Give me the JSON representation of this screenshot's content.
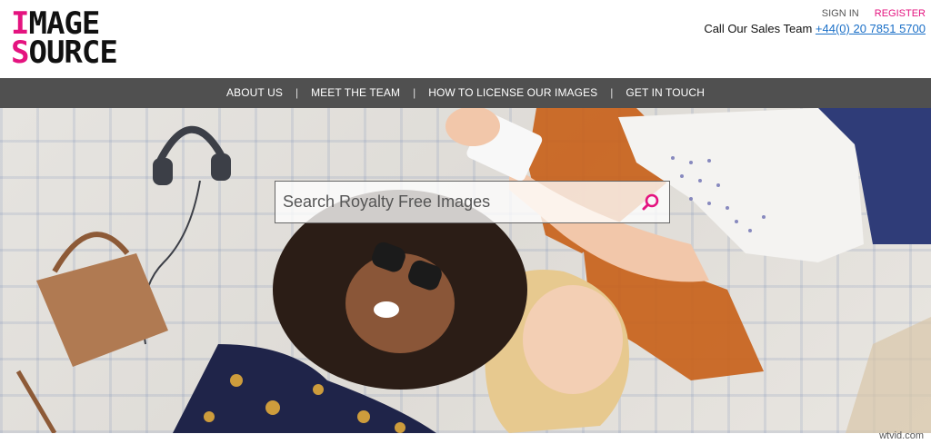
{
  "brand": {
    "logo_line1": "IMAGE",
    "logo_line2": "SOURCE",
    "accent_color": "#e4137f"
  },
  "header": {
    "sign_in": "SIGN IN",
    "register": "REGISTER",
    "sales_label": "Call Our Sales Team",
    "sales_phone": "+44(0) 20 7851 5700"
  },
  "nav": {
    "items": [
      {
        "label": "ABOUT US"
      },
      {
        "label": "MEET THE TEAM"
      },
      {
        "label": "HOW TO LICENSE OUR IMAGES"
      },
      {
        "label": "GET IN TOUCH"
      }
    ],
    "separator": "|",
    "background": "#505050"
  },
  "hero": {
    "search": {
      "placeholder": "Search Royalty Free Images",
      "button_icon": "magnifier-icon"
    }
  },
  "watermark": "wtvid.com"
}
